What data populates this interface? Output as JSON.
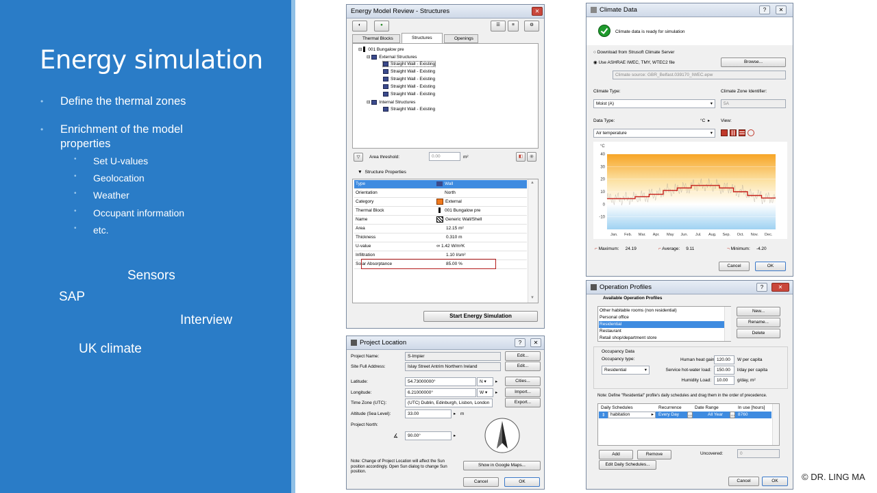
{
  "slide": {
    "title": "Energy simulation",
    "bullets": [
      "Define the thermal zones",
      "Enrichment of the model properties"
    ],
    "sub_bullets": [
      "Set U-values",
      "Geolocation",
      "Weather",
      "Occupant information",
      "etc."
    ],
    "floating_words": [
      "Sensors",
      "SAP",
      "Interview",
      "UK climate"
    ],
    "copyright": "© DR. LING MA"
  },
  "structures": {
    "title": "Energy Model Review - Structures",
    "tabs": [
      "Thermal Blocks",
      "Structures",
      "Openings"
    ],
    "tree_root": "001 Bungalow pre",
    "external_group": "External Structures",
    "external_items": [
      "Straight Wall - Existing",
      "Straight Wall - Existing",
      "Straight Wall - Existing",
      "Straight Wall - Existing",
      "Straight Wall - Existing"
    ],
    "internal_group": "Internal Structures",
    "internal_items": [
      "Straight Wall - Existing"
    ],
    "area_threshold_label": "Area threshold:",
    "area_threshold_value": "0.00",
    "area_unit": "m²",
    "props_header": "Structure Properties",
    "props": [
      {
        "k": "Type",
        "v": "Wall"
      },
      {
        "k": "Orientation",
        "v": "North"
      },
      {
        "k": "Category",
        "v": "External"
      },
      {
        "k": "Thermal Block",
        "v": "001 Bungalow pre"
      },
      {
        "k": "Name",
        "v": "Generic Wall/Shell"
      },
      {
        "k": "Area",
        "v": "12.15 m²"
      },
      {
        "k": "Thickness",
        "v": "0.310 m"
      },
      {
        "k": "U-value",
        "v": "1.42 W/m²K"
      },
      {
        "k": "Infiltration",
        "v": "1.10 l/sm²"
      },
      {
        "k": "Solar Absorptance",
        "v": "85.00 %"
      }
    ],
    "start_button": "Start Energy Simulation"
  },
  "location": {
    "title": "Project Location",
    "project_name_label": "Project Name:",
    "project_name": "S-Impier",
    "site_label": "Site Full Address:",
    "site": "Islay Street Antrim Northern Ireland",
    "edit": "Edit...",
    "latitude_label": "Latitude:",
    "latitude": "54.73000000°",
    "lat_dir": "N",
    "longitude_label": "Longitude:",
    "longitude": "6.21000000°",
    "lon_dir": "W",
    "timezone_label": "Time Zone (UTC):",
    "timezone": "(UTC) Dublin, Edinburgh, Lisbon, London",
    "altitude_label": "Altitude (Sea Level):",
    "altitude": "33.00",
    "altitude_unit": "m",
    "north_label": "Project North:",
    "north": "90.00°",
    "cities": "Cities...",
    "import": "Import...",
    "export": "Export...",
    "note": "Note: Change of Project Location will affect the Sun position accordingly. Open Sun dialog to change Sun position.",
    "maps": "Show in Google Maps...",
    "cancel": "Cancel",
    "ok": "OK"
  },
  "climate": {
    "title": "Climate Data",
    "ready": "Climate data is ready for simulation",
    "opt1": "Download from Strusoft Climate Server",
    "opt2": "Use ASHRAE IWEC, TMY, WTEC2 file",
    "browse": "Browse...",
    "source": "Climate source: GBR_Belfast.039170_IWEC.epw",
    "climate_type_label": "Climate Type:",
    "climate_type": "Moist (A)",
    "zone_label": "Climate Zone Identifier:",
    "zone": "5A",
    "data_type_label": "Data Type:",
    "data_type": "Air temperature",
    "unit_label": "°C",
    "view_label": "View:",
    "max_label": "Maximum:",
    "max": "24.19",
    "avg_label": "Average:",
    "avg": "9.11",
    "min_label": "Minimum:",
    "min": "-4.20",
    "cancel": "Cancel",
    "ok": "OK"
  },
  "chart_data": {
    "type": "line",
    "ylabel": "°C",
    "ylim": [
      -20,
      40
    ],
    "yticks": [
      "40",
      "30",
      "20",
      "10",
      "0",
      "-10"
    ],
    "categories": [
      "Jan.",
      "Feb.",
      "Mar.",
      "Apr.",
      "May",
      "Jun.",
      "Jul.",
      "Aug.",
      "Sep.",
      "Oct.",
      "Nov.",
      "Dec."
    ],
    "series": [
      {
        "values": [
          4.5,
          4.5,
          6,
          8,
          11,
          13,
          15,
          15,
          13,
          10,
          7,
          5
        ]
      }
    ]
  },
  "operation": {
    "title": "Operation Profiles",
    "available_label": "Available Operation Profiles",
    "profiles": [
      "Other habitable rooms (non residential)",
      "Personal office",
      "Residential",
      "Restaurant",
      "Retail shop/department store"
    ],
    "selected_index": 2,
    "new": "New...",
    "rename": "Rename...",
    "delete": "Delete",
    "occupancy_data": "Occupancy Data",
    "occupancy_type_label": "Occupancy type:",
    "occupancy_type": "Residential",
    "heat_gain_label": "Human heat gain:",
    "heat_gain": "120.00",
    "heat_gain_unit": "W per capita",
    "hot_water_label": "Service hot-water load:",
    "hot_water": "150.00",
    "hot_water_unit": "l/day per capita",
    "humidity_label": "Humidity Load:",
    "humidity": "10.00",
    "humidity_unit": "g/day, m²",
    "note": "Note: Define \"Residential\" profile's daily schedules and drag them in the order of precedence.",
    "col_daily": "Daily Schedules",
    "col_recurrence": "Recurrence",
    "col_date": "Date Range",
    "col_inuse": "In use [hours]",
    "row_daily": "habitation",
    "row_recurrence": "Every Day",
    "row_date": "All Year",
    "row_inuse": "8760",
    "add": "Add",
    "remove": "Remove",
    "uncovered_label": "Uncovered:",
    "uncovered": "0",
    "edit_schedules": "Edit Daily Schedules...",
    "cancel": "Cancel",
    "ok": "OK"
  }
}
